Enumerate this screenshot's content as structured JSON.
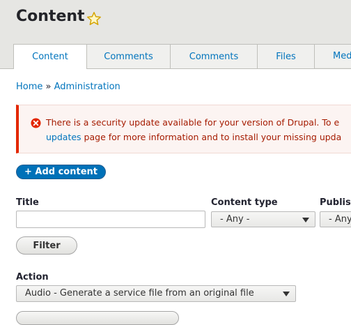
{
  "header": {
    "title": "Content",
    "tabs": [
      {
        "label": "Content",
        "active": true
      },
      {
        "label": "Comments",
        "active": false
      },
      {
        "label": "Comments",
        "active": false
      },
      {
        "label": "Files",
        "active": false
      },
      {
        "label": "Med",
        "active": false
      }
    ]
  },
  "breadcrumb": {
    "home": "Home",
    "separator": "»",
    "admin": "Administration"
  },
  "message": {
    "line1": "There is a security update available for your version of Drupal. To e",
    "link": "updates",
    "line2_rest": " page for more information and to install your missing upda"
  },
  "actions": {
    "add_content": "+ Add content"
  },
  "filters": {
    "title_label": "Title",
    "title_value": "",
    "content_type_label": "Content type",
    "content_type_value": "- Any -",
    "published_label": "Publis",
    "published_value": "- Any",
    "filter_button": "Filter"
  },
  "bulk": {
    "action_label": "Action",
    "action_value": "Audio - Generate a service file from an original file"
  },
  "colors": {
    "accent": "#0074bd",
    "error": "#e32700",
    "header_bg": "#e6e6e3"
  },
  "icons": {
    "favorite": "star-icon",
    "error": "error-icon",
    "dropdown": "chevron-down-icon"
  }
}
